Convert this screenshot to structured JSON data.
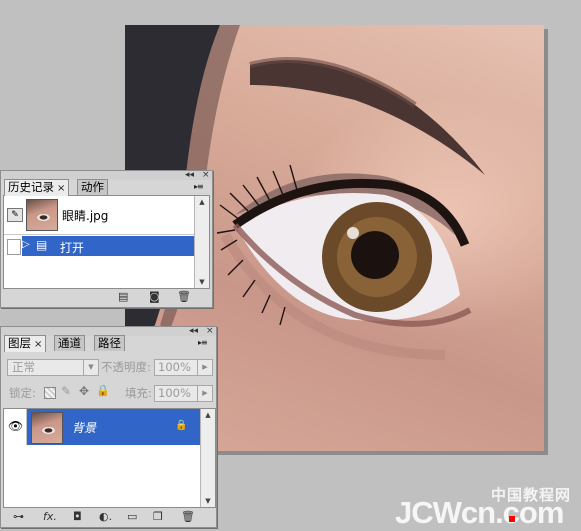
{
  "history_panel": {
    "tabs": [
      {
        "label": "历史记录",
        "close": "×",
        "active": true
      },
      {
        "label": "动作",
        "active": false
      }
    ],
    "snapshot_name": "眼睛.jpg",
    "states": [
      {
        "label": "打开",
        "selected": true
      }
    ],
    "title_buttons": {
      "minimize": "◂◂",
      "close": "×"
    },
    "menu_glyph": "▸≡"
  },
  "layers_panel": {
    "tabs": [
      {
        "label": "图层",
        "close": "×",
        "active": true
      },
      {
        "label": "通道",
        "active": false
      },
      {
        "label": "路径",
        "active": false
      }
    ],
    "blend_mode": "正常",
    "opacity_label": "不透明度:",
    "opacity_value": "100%",
    "lock_label": "锁定:",
    "fill_label": "填充:",
    "fill_value": "100%",
    "layers": [
      {
        "name": "背景",
        "visible": true,
        "locked": true,
        "selected": true
      }
    ],
    "title_buttons": {
      "minimize": "◂◂",
      "close": "×"
    },
    "menu_glyph": "▸≡"
  },
  "watermark": {
    "cn": "中国教程网",
    "en": "JCWcn.com"
  },
  "colors": {
    "selection": "#3166c8",
    "panel_bg": "#d6d6d6",
    "workspace": "#c0c0c0",
    "watermark_dot": "#ff0000"
  }
}
